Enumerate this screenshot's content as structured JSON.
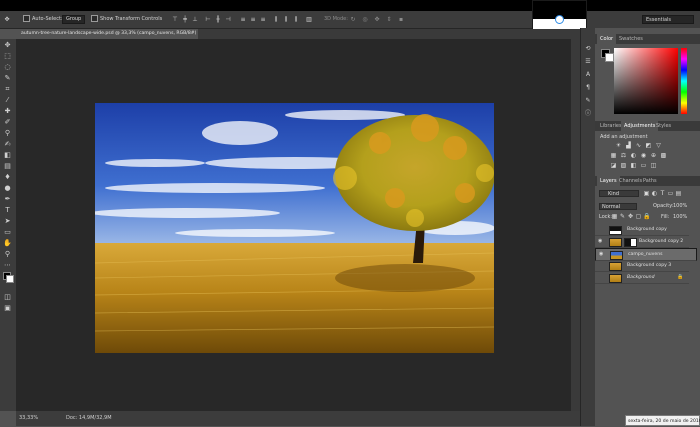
{
  "options_bar": {
    "auto_select_label": "Auto-Select:",
    "auto_select_value": "Group",
    "show_transform_label": "Show Transform Controls",
    "mode_3d_label": "3D Mode:",
    "workspace": "Essentials"
  },
  "document": {
    "tab_title": "autumn-tree-nature-landscape-wide.psd @ 33,3% (campo_nuvens, RGB/8#) *",
    "zoom": "33,33%",
    "doc_info": "Doc: 14,9M/32,9M"
  },
  "color_panel": {
    "tabs": [
      "Color",
      "Swatches"
    ],
    "active_tab": "Color",
    "hue_hex": "#ff0000"
  },
  "adjustments_panel": {
    "tabs": [
      "Libraries",
      "Adjustments",
      "Styles"
    ],
    "active_tab": "Adjustments",
    "heading": "Add an adjustment"
  },
  "layers_panel": {
    "tabs": [
      "Layers",
      "Channels",
      "Paths"
    ],
    "active_tab": "Layers",
    "filter_kind": "Kind",
    "blend_mode": "Normal",
    "opacity_label": "Opacity:",
    "opacity_value": "100%",
    "lock_label": "Lock:",
    "fill_label": "Fill:",
    "fill_value": "100%",
    "layers": [
      {
        "name": "Background copy",
        "visible": false,
        "selected": false
      },
      {
        "name": "Background copy 2",
        "visible": true,
        "selected": false
      },
      {
        "name": "campo_nuvens",
        "visible": true,
        "selected": true
      },
      {
        "name": "Background copy 3",
        "visible": false,
        "selected": false
      },
      {
        "name": "Background",
        "visible": false,
        "selected": false
      }
    ]
  },
  "tooltip": "sexta-feira, 20 de maio de 2016"
}
